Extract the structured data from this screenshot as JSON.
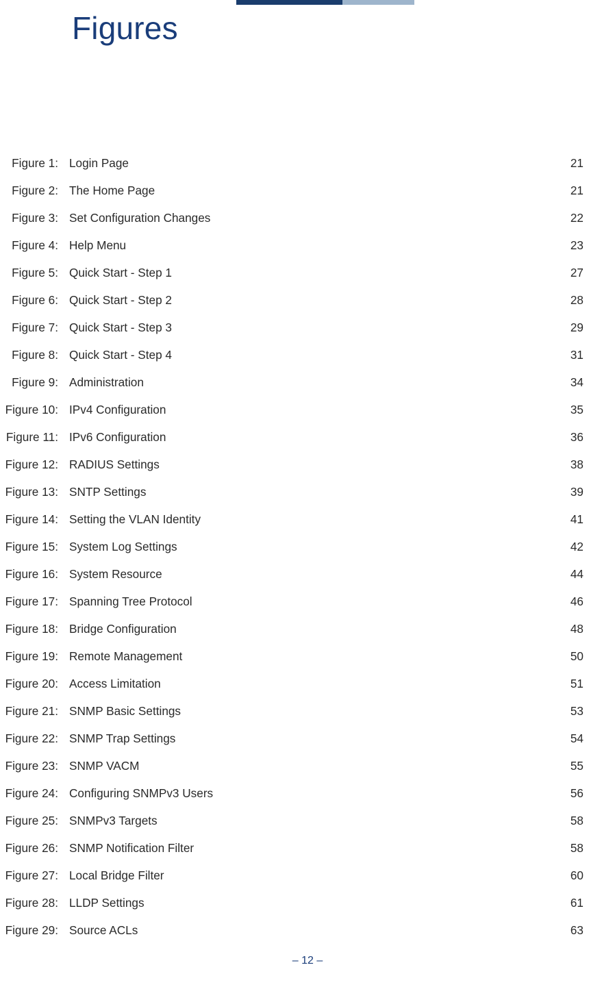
{
  "title": "Figures",
  "page_number": "–  12  –",
  "figures": [
    {
      "label": "Figure 1:",
      "title": "Login Page",
      "page": "21"
    },
    {
      "label": "Figure 2:",
      "title": "The Home Page",
      "page": "21"
    },
    {
      "label": "Figure 3:",
      "title": "Set Configuration Changes",
      "page": "22"
    },
    {
      "label": "Figure 4:",
      "title": "Help Menu",
      "page": "23"
    },
    {
      "label": "Figure 5:",
      "title": "Quick Start - Step 1",
      "page": "27"
    },
    {
      "label": "Figure 6:",
      "title": "Quick Start - Step 2",
      "page": "28"
    },
    {
      "label": "Figure 7:",
      "title": "Quick Start - Step 3",
      "page": "29"
    },
    {
      "label": "Figure 8:",
      "title": "Quick Start - Step 4",
      "page": "31"
    },
    {
      "label": "Figure 9:",
      "title": "Administration",
      "page": "34"
    },
    {
      "label": "Figure 10:",
      "title": "IPv4 Configuration",
      "page": "35"
    },
    {
      "label": "Figure 11:",
      "title": "IPv6 Configuration",
      "page": "36"
    },
    {
      "label": "Figure 12:",
      "title": "RADIUS Settings",
      "page": "38"
    },
    {
      "label": "Figure 13:",
      "title": "SNTP Settings",
      "page": "39"
    },
    {
      "label": "Figure 14:",
      "title": "Setting the VLAN Identity",
      "page": "41"
    },
    {
      "label": "Figure 15:",
      "title": "System Log Settings",
      "page": "42"
    },
    {
      "label": "Figure 16:",
      "title": "System Resource",
      "page": "44"
    },
    {
      "label": "Figure 17:",
      "title": "Spanning Tree Protocol",
      "page": "46"
    },
    {
      "label": "Figure 18:",
      "title": "Bridge Configuration",
      "page": "48"
    },
    {
      "label": "Figure 19:",
      "title": "Remote Management",
      "page": "50"
    },
    {
      "label": "Figure 20:",
      "title": "Access Limitation",
      "page": "51"
    },
    {
      "label": "Figure 21:",
      "title": "SNMP Basic Settings",
      "page": "53"
    },
    {
      "label": "Figure 22:",
      "title": "SNMP Trap Settings",
      "page": "54"
    },
    {
      "label": "Figure 23:",
      "title": "SNMP VACM",
      "page": "55"
    },
    {
      "label": "Figure 24:",
      "title": "Configuring SNMPv3 Users",
      "page": "56"
    },
    {
      "label": "Figure 25:",
      "title": "SNMPv3 Targets",
      "page": "58"
    },
    {
      "label": "Figure 26:",
      "title": "SNMP Notification Filter",
      "page": "58"
    },
    {
      "label": "Figure 27:",
      "title": "Local Bridge Filter",
      "page": "60"
    },
    {
      "label": "Figure 28:",
      "title": "LLDP Settings",
      "page": "61"
    },
    {
      "label": "Figure 29:",
      "title": "Source ACLs",
      "page": "63"
    }
  ]
}
